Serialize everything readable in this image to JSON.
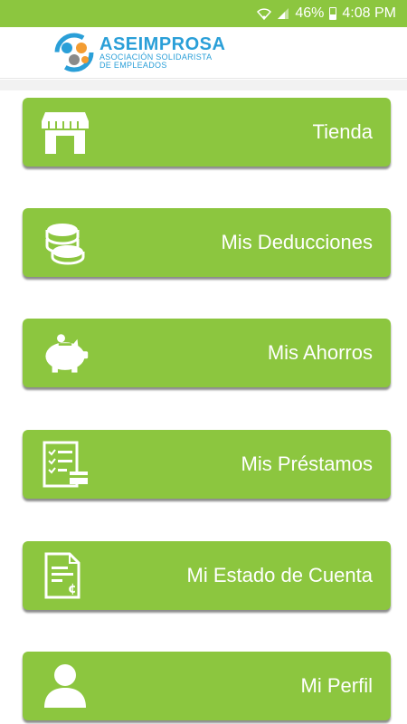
{
  "status_bar": {
    "battery": "46%",
    "time": "4:08 PM"
  },
  "header": {
    "logo_name": "ASEIMPROSA",
    "logo_tagline_1": "ASOCIACIÓN SOLIDARISTA",
    "logo_tagline_2": "DE EMPLEADOS"
  },
  "menu": {
    "items": [
      {
        "label": "Tienda",
        "icon": "store-icon"
      },
      {
        "label": "Mis Deducciones",
        "icon": "coins-icon"
      },
      {
        "label": "Mis Ahorros",
        "icon": "piggy-bank-icon"
      },
      {
        "label": "Mis Préstamos",
        "icon": "loan-document-icon"
      },
      {
        "label": "Mi Estado de Cuenta",
        "icon": "account-statement-icon"
      },
      {
        "label": "Mi Perfil",
        "icon": "user-icon"
      }
    ]
  },
  "colors": {
    "accent": "#8cc63f",
    "brand_blue": "#2a9fd8",
    "brand_orange": "#f39c32",
    "brand_gray": "#8a8a8a"
  }
}
